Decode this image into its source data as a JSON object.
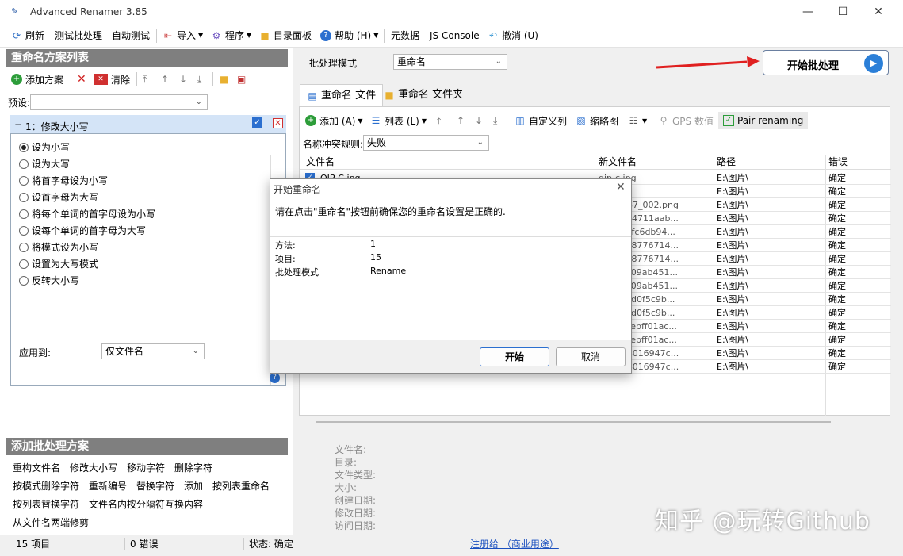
{
  "window": {
    "title": "Advanced Renamer 3.85",
    "icon_name": "app-logo-icon",
    "controls": [
      "minimize",
      "maximize",
      "close"
    ]
  },
  "toolbar": {
    "refresh": "刷新",
    "test_batch": "测试批处理",
    "auto_test": "自动测试",
    "import": "导入",
    "program": "程序",
    "dir_panel": "目录面板",
    "help": "帮助 (H)",
    "metadata": "元数据",
    "js_console": "JS Console",
    "undo": "撤消 (U)"
  },
  "left_panel": {
    "header": "重命名方案列表",
    "add_method": "添加方案",
    "clear": "清除",
    "preset_label": "预设:",
    "preset_value": "",
    "method": {
      "title": "1：修改大小写",
      "options": [
        {
          "label": "设为小写",
          "selected": true
        },
        {
          "label": "设为大写",
          "selected": false
        },
        {
          "label": "将首字母设为小写",
          "selected": false
        },
        {
          "label": "设首字母为大写",
          "selected": false
        },
        {
          "label": "将每个单词的首字母设为小写",
          "selected": false
        },
        {
          "label": "设每个单词的首字母为大写",
          "selected": false
        },
        {
          "label": "将模式设为小写",
          "selected": false
        },
        {
          "label": "设置为大写模式",
          "selected": false
        },
        {
          "label": "反转大小写",
          "selected": false
        }
      ],
      "apply_to_label": "应用到:",
      "apply_to_value": "仅文件名"
    },
    "add_header": "添加批处理方案",
    "add_items": [
      [
        "重构文件名",
        "修改大小写",
        "移动字符",
        "删除字符"
      ],
      [
        "按模式删除字符",
        "重新编号",
        "替换字符",
        "添加",
        "按列表重命名"
      ],
      [
        "按列表替换字符",
        "文件名内按分隔符互换内容"
      ],
      [
        "从文件名两端修剪"
      ]
    ]
  },
  "right_panel": {
    "batch_mode_label": "批处理模式",
    "batch_mode_value": "重命名",
    "start_button": "开始批处理",
    "tabs": [
      {
        "label": "重命名 文件",
        "active": true
      },
      {
        "label": "重命名 文件夹",
        "active": false
      }
    ],
    "file_toolbar": {
      "add": "添加 (A)",
      "list": "列表 (L)",
      "custom_columns": "自定义列",
      "thumbnails": "缩略图",
      "gps": "GPS 数值",
      "pair_renaming": "Pair renaming"
    },
    "conflict_label": "名称冲突规则:",
    "conflict_value": "失败",
    "columns": [
      "文件名",
      "新文件名",
      "路径",
      "错误"
    ],
    "rows": [
      {
        "name": "QIP-C.jpg",
        "new": "qip-c.jpg",
        "path": "E:\\图片\\",
        "err": "确定"
      },
      {
        "name": "",
        "new": "",
        "path": "E:\\图片\\",
        "err": "确定"
      },
      {
        "name": "",
        "new": "ren_3_87_002.png",
        "path": "E:\\图片\\",
        "err": "确定"
      },
      {
        "name": "",
        "new": "35571b4711aab...",
        "path": "E:\\图片\\",
        "err": "确定"
      },
      {
        "name": "",
        "new": "089ee9fc6db94...",
        "path": "E:\\图片\\",
        "err": "确定"
      },
      {
        "name": "",
        "new": "886eed8776714...",
        "path": "E:\\图片\\",
        "err": "确定"
      },
      {
        "name": "",
        "new": "886eed8776714...",
        "path": "E:\\图片\\",
        "err": "确定"
      },
      {
        "name": "",
        "new": "45e5c109ab451...",
        "path": "E:\\图片\\",
        "err": "确定"
      },
      {
        "name": "",
        "new": "45e5c109ab451...",
        "path": "E:\\图片\\",
        "err": "确定"
      },
      {
        "name": "",
        "new": "c7d5d8d0f5c9b...",
        "path": "E:\\图片\\",
        "err": "确定"
      },
      {
        "name": "",
        "new": "c7d5d8d0f5c9b...",
        "path": "E:\\图片\\",
        "err": "确定"
      },
      {
        "name": "",
        "new": "acaa0bebff01ac...",
        "path": "E:\\图片\\",
        "err": "确定"
      },
      {
        "name": "",
        "new": "acaa0bebff01ac...",
        "path": "E:\\图片\\",
        "err": "确定"
      },
      {
        "name": "",
        "new": "8dfbfb4016947c...",
        "path": "E:\\图片\\",
        "err": "确定"
      },
      {
        "name": "",
        "new": "8dfbfb4016947c...",
        "path": "E:\\图片\\",
        "err": "确定"
      }
    ],
    "info_labels": [
      "文件名:",
      "目录:",
      "文件类型:",
      "大小:",
      "创建日期:",
      "修改日期:",
      "访问日期:"
    ]
  },
  "status": {
    "items": "15 项目",
    "errors": "0 错误",
    "state": "状态: 确定",
    "registered": "注册给 （商业用途）"
  },
  "dialog": {
    "title": "开始重命名",
    "message": "请在点击\"重命名\"按钮前确保您的重命名设置是正确的.",
    "details": [
      {
        "k": "方法:",
        "v": "1"
      },
      {
        "k": "项目:",
        "v": "15"
      },
      {
        "k": "批处理模式",
        "v": "Rename"
      }
    ],
    "ok": "开始",
    "cancel": "取消"
  },
  "watermark": "知乎 @玩转Github",
  "colors": {
    "accent_blue": "#2b7fd8",
    "panel_header": "#7f7f7f",
    "arrow_red": "#e02020"
  }
}
